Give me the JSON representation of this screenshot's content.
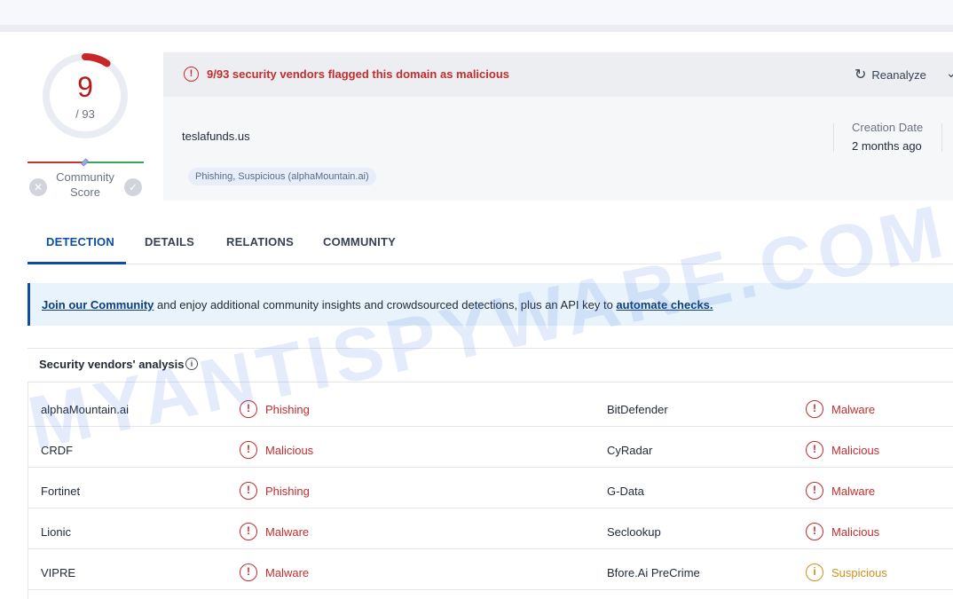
{
  "score": {
    "value": "9",
    "total": "/ 93",
    "community_label": "Community\nScore"
  },
  "alert": {
    "text": "9/93 security vendors flagged this domain as malicious",
    "icon": "alert-circle-icon"
  },
  "actions": {
    "reanalyze_label": "Reanalyze"
  },
  "domain": {
    "name": "teslafunds.us",
    "tag": "Phishing, Suspicious (alphaMountain.ai)"
  },
  "meta": {
    "creation_label": "Creation Date",
    "creation_value": "2 months ago"
  },
  "tabs": [
    {
      "label": "DETECTION"
    },
    {
      "label": "DETAILS"
    },
    {
      "label": "RELATIONS"
    },
    {
      "label": "COMMUNITY"
    }
  ],
  "banner": {
    "link1": "Join our Community",
    "middle": " and enjoy additional community insights and crowdsourced detections, plus an API key to ",
    "link2": "automate checks."
  },
  "vendors_section": {
    "title": "Security vendors' analysis"
  },
  "rows": [
    {
      "left_vendor": "alphaMountain.ai",
      "left_verdict": "Phishing",
      "right_vendor": "BitDefender",
      "right_verdict": "Malware"
    },
    {
      "left_vendor": "CRDF",
      "left_verdict": "Malicious",
      "right_vendor": "CyRadar",
      "right_verdict": "Malicious"
    },
    {
      "left_vendor": "Fortinet",
      "left_verdict": "Phishing",
      "right_vendor": "G-Data",
      "right_verdict": "Malware"
    },
    {
      "left_vendor": "Lionic",
      "left_verdict": "Malware",
      "right_vendor": "Seclookup",
      "right_verdict": "Malicious"
    },
    {
      "left_vendor": "VIPRE",
      "left_verdict": "Malware",
      "right_vendor": "Bfore.Ai PreCrime",
      "right_verdict": "Suspicious"
    }
  ],
  "watermark": "MYANTISPYWARE.COM",
  "colors": {
    "malicious": "#c22d2d",
    "suspicious": "#d0901a",
    "accent": "#0b4ea2"
  }
}
